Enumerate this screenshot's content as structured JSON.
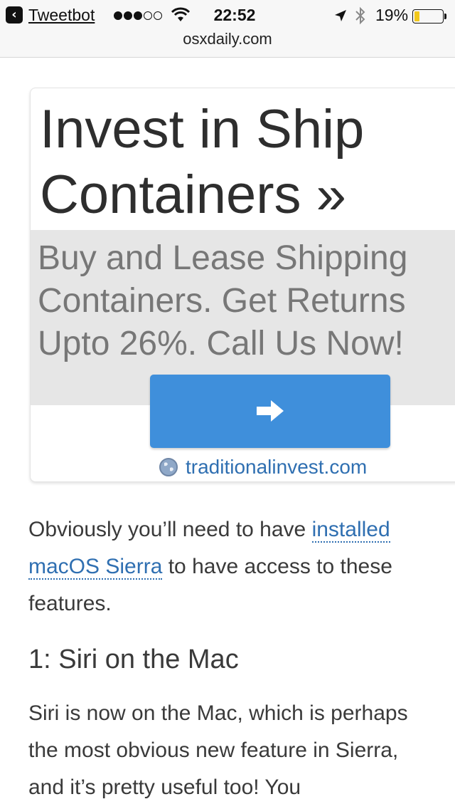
{
  "status_bar": {
    "back_app": "Tweetbot",
    "time": "22:52",
    "battery_percent": "19%",
    "battery_level": 0.19,
    "signal_bars_filled": 3,
    "signal_bars_total": 5,
    "url": "osxdaily.com"
  },
  "ad": {
    "title": "Invest in Ship Containers »",
    "description": "Buy and Lease Shipping Containers. Get Returns Upto 26%. Call Us Now!",
    "domain": "traditionalinvest.com",
    "button_icon": "arrow-right-icon",
    "button_color": "#3f8fdb"
  },
  "article": {
    "intro_before": "Obviously you’ll need to have ",
    "intro_link": "installed macOS Sierra",
    "intro_after": " to have access to these features.",
    "heading": "1: Siri on the Mac",
    "paragraph": "Siri is now on the Mac, which is perhaps the most obvious new feature in Sierra, and it’s pretty useful too! You"
  },
  "colors": {
    "link": "#2f6fb1",
    "ad_body_bg": "#e6e6e6",
    "battery_fill": "#f2c81b"
  }
}
